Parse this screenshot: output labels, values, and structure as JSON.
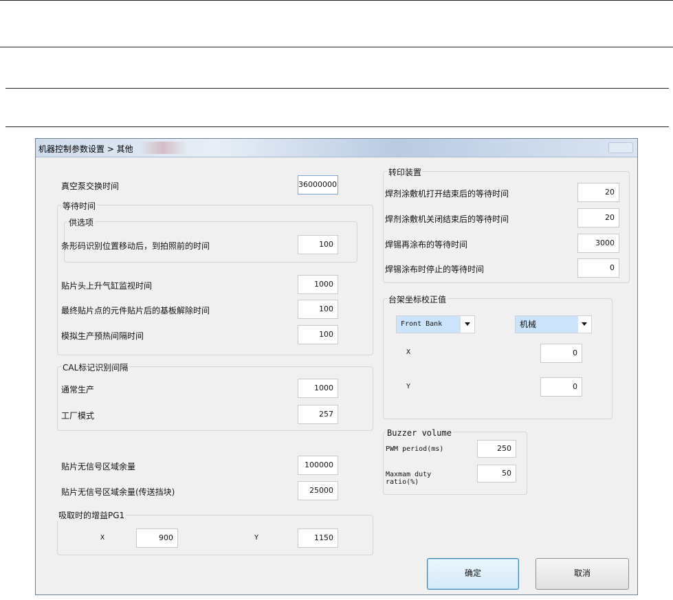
{
  "window": {
    "title": "机器控制参数设置 > 其他"
  },
  "left": {
    "vacuum_label": "真空泵交换时间",
    "vacuum_value": "36000000",
    "wait_group_title": "等待时间",
    "option_group_title": "供选项",
    "barcode_label": "条形码识别位置移动后，到拍照前的时间",
    "barcode_value": "100",
    "cylinder_label": "贴片头上升气缸监视时间",
    "cylinder_value": "1000",
    "release_label": "最终贴片点的元件贴片后的基板解除时间",
    "release_value": "100",
    "preheat_label": "模拟生产预热间隔时间",
    "preheat_value": "100",
    "cal_group_title": "CAL标记识别间隔",
    "normal_label": "通常生产",
    "normal_value": "1000",
    "factory_label": "工厂模式",
    "factory_value": "257",
    "nosignal_label": "贴片无信号区域余量",
    "nosignal_value": "100000",
    "nosignal_conv_label": "贴片无信号区域余量(传送挡块)",
    "nosignal_conv_value": "25000",
    "gain_group_title": "吸取时的增益PG1",
    "gain_x_label": "X",
    "gain_x_value": "900",
    "gain_y_label": "Y",
    "gain_y_value": "1150"
  },
  "right": {
    "transfer_group_title": "转印装置",
    "flux_open_label": "焊剂涂敷机打开结束后的等待时间",
    "flux_open_value": "20",
    "flux_close_label": "焊剂涂敷机关闭结束后的等待时间",
    "flux_close_value": "20",
    "solder_recoat_label": "焊锡再涂布的等待时间",
    "solder_recoat_value": "3000",
    "solder_stop_label": "焊锡涂布时停止的等待时间",
    "solder_stop_value": "0",
    "gantry_group_title": "台架坐标校正值",
    "bank_select": "Front Bank",
    "mode_select": "机械",
    "gantry_x_label": "X",
    "gantry_x_value": "0",
    "gantry_y_label": "Y",
    "gantry_y_value": "0",
    "buzzer_group_title": "Buzzer volume",
    "pwm_label": "PWM period(ms)",
    "pwm_value": "250",
    "duty_label": "Maxmam duty\nratio(%)",
    "duty_value": "50"
  },
  "buttons": {
    "ok": "确定",
    "cancel": "取消"
  }
}
